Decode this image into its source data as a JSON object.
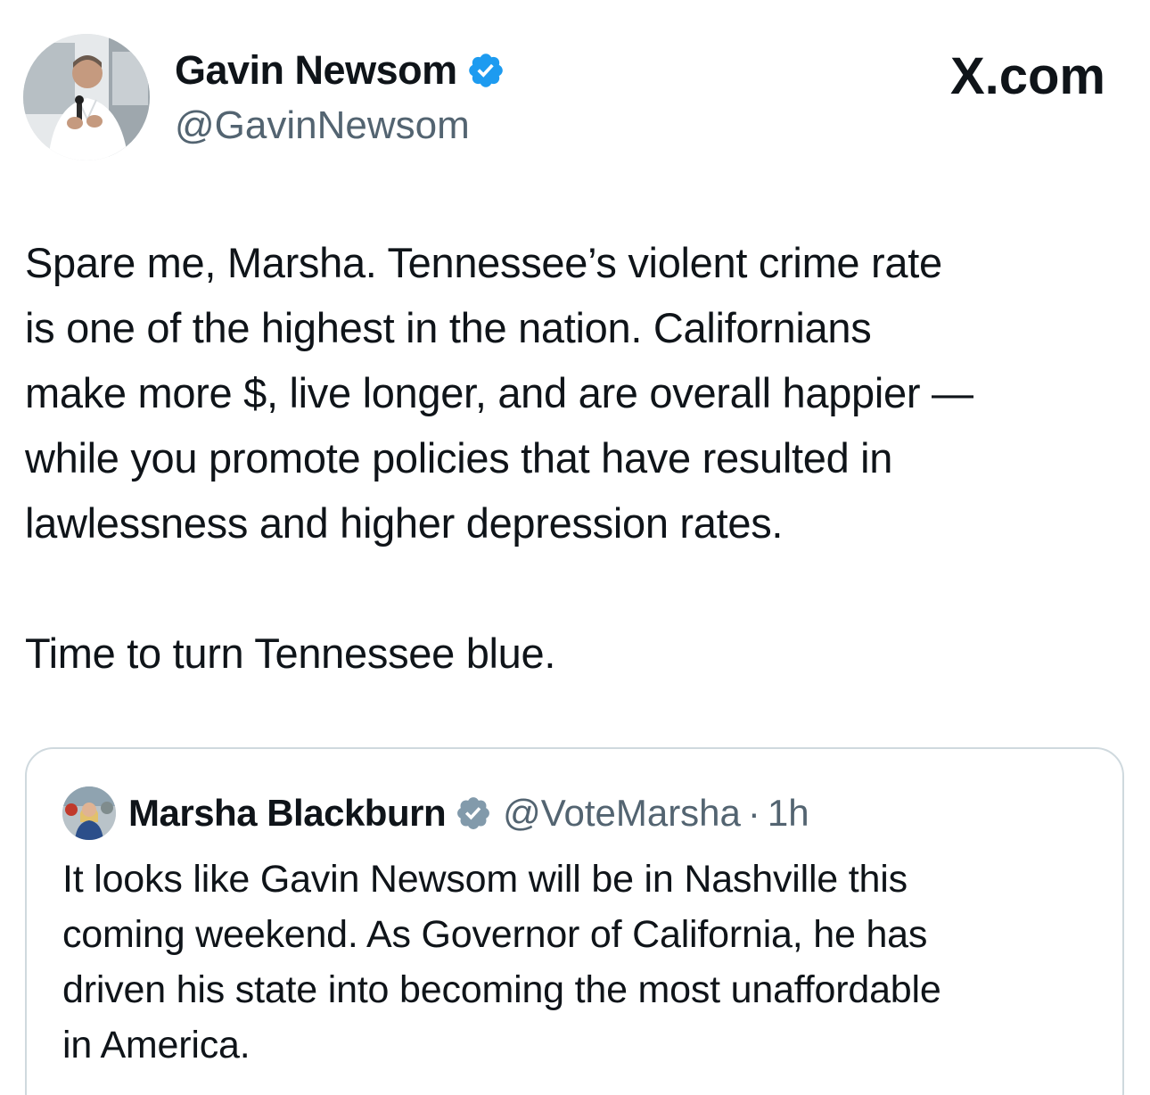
{
  "source_logo": "X.com",
  "tweet": {
    "author_name": "Gavin Newsom",
    "author_handle": "@GavinNewsom",
    "verified_icon": "verified-badge-blue",
    "paragraphs": [
      "Spare me, Marsha. Tennessee’s violent crime rate\nis one of the highest in the nation. Californians\nmake more $, live longer, and are overall happier —\nwhile you promote policies that have resulted in\nlawlessness and higher depression rates.",
      "Time to turn Tennessee blue."
    ]
  },
  "quoted_tweet": {
    "author_name": "Marsha Blackburn",
    "author_handle": "@VoteMarsha",
    "separator": "·",
    "time": "1h",
    "verified_icon": "verified-badge-gray",
    "text": "It looks like Gavin Newsom will be in Nashville this\ncoming weekend. As Governor of California, he has\ndriven his state into becoming the most unaffordable\nin America."
  },
  "colors": {
    "text_primary": "#0f1419",
    "text_secondary": "#536471",
    "verified_blue": "#1d9bf0",
    "verified_gray": "#829aab",
    "card_border": "#cfd9de"
  }
}
